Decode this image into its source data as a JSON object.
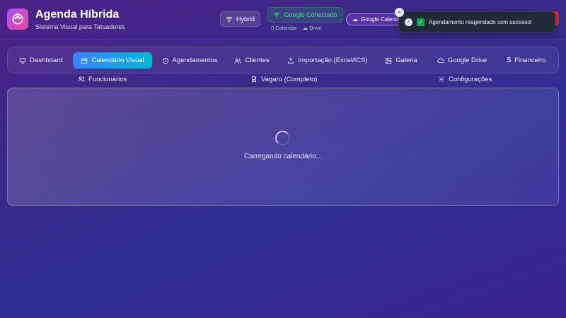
{
  "app": {
    "title": "Agenda Híbrida",
    "subtitle": "Sistema Visual para Tatuadores"
  },
  "header": {
    "mode_label": "Hybrid",
    "google_status": "Google Conectado",
    "calendar_link": "Calendar",
    "drive_link": "Drive",
    "google_calendar_button": "Google Calendar"
  },
  "toast": {
    "message": "Agendamento reagendado com sucesso!",
    "close": "×"
  },
  "nav": {
    "tabs": [
      {
        "label": "Dashboard",
        "icon": "monitor-icon"
      },
      {
        "label": "Calendário Visual",
        "icon": "calendar-icon",
        "active": true
      },
      {
        "label": "Agendamentos",
        "icon": "clock-icon"
      },
      {
        "label": "Clientes",
        "icon": "users-icon"
      },
      {
        "label": "Importação (Excel/ICS)",
        "icon": "upload-icon"
      },
      {
        "label": "Galeria",
        "icon": "image-icon"
      },
      {
        "label": "Google Drive",
        "icon": "cloud-icon"
      },
      {
        "label": "Financeiro",
        "icon": "dollar-icon"
      }
    ],
    "secondary": [
      {
        "label": "Funcionários",
        "icon": "users-icon"
      },
      {
        "label": "Vagaro (Completo)",
        "icon": "file-icon"
      },
      {
        "label": "Configurações",
        "icon": "gear-icon"
      }
    ]
  },
  "main": {
    "loading_text": "Carregando calendário..."
  },
  "colors": {
    "accent_active_tab": "#3b82f6",
    "google_connected": "#4ade80",
    "toast_bg": "#1f2937"
  }
}
